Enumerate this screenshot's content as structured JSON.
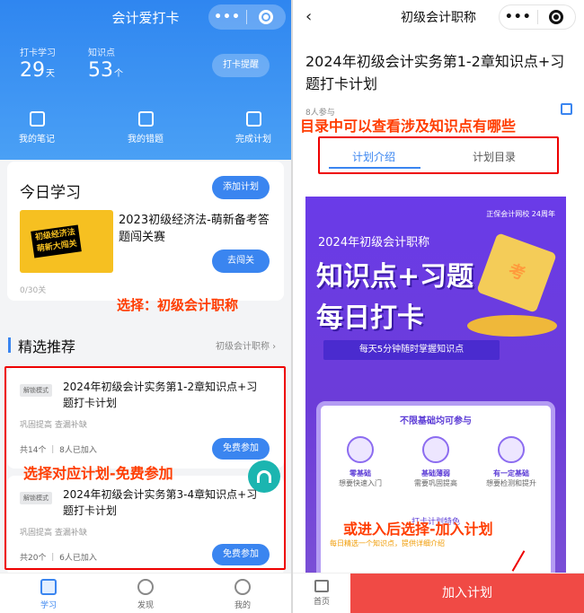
{
  "left": {
    "app_title": "会计爱打卡",
    "stats": [
      {
        "label": "打卡学习",
        "value": "29",
        "unit": "天"
      },
      {
        "label": "知识点",
        "value": "53",
        "unit": "个"
      }
    ],
    "remind_label": "打卡提醒",
    "quick_links": [
      "我的笔记",
      "我的错题",
      "完成计划"
    ],
    "today": {
      "heading": "今日学习",
      "add_plan_label": "添加计划",
      "cover_text_line1": "初级经济法",
      "cover_text_line2": "萌新大闯关",
      "course_title": "2023初级经济法-萌新备考答题闯关赛",
      "go_label": "去闯关",
      "progress": "0/30关"
    },
    "annotation_select": "选择：初级会计职称",
    "section_heading": "精选推荐",
    "filter_link": "初级会计职称 ›",
    "items": [
      {
        "badge": "解锁模式",
        "title": "2024年初级会计实务第1-2章知识点+习题打卡计划",
        "tags": "巩固提高 查漏补缺",
        "stats": "共14个 ｜ 8人已加入",
        "cta": "免费参加"
      },
      {
        "badge": "解锁模式",
        "title": "2024年初级会计实务第3-4章知识点+习题打卡计划",
        "tags": "巩固提高 查漏补缺",
        "stats": "共20个 ｜ 6人已加入",
        "cta": "免费参加"
      }
    ],
    "annotation_join": "选择对应计划-免费参加",
    "tabbar": [
      "学习",
      "发现",
      "我的"
    ]
  },
  "right": {
    "nav_title": "初级会计职称",
    "back": "‹",
    "plan_title": "2024年初级会计实务第1-2章知识点+习题打卡计划",
    "joined": "8人参与",
    "annotation_catalog": "目录中可以查看涉及知识点有哪些",
    "tabs": [
      "计划介绍",
      "计划目录"
    ],
    "poster": {
      "brand": "正保会计网校 24周年",
      "year_title": "2024年初级会计职称",
      "big_line1": "知识点+习题",
      "big_line2": "每日打卡",
      "cube_text": "考",
      "subtitle": "每天5分钟随时掌握知识点",
      "card_heading": "不限基础均可参与",
      "features": [
        {
          "title": "零基础",
          "desc": "想要快速入门"
        },
        {
          "title": "基础薄弱",
          "desc": "需要巩固提高"
        },
        {
          "title": "有一定基础",
          "desc": "想要检测和提升"
        }
      ],
      "card_footer": "打卡计划特色",
      "card_line": "每日精选一个知识点，提供详细介绍"
    },
    "annotation_enter": "或进入后选择-加入计划",
    "home_label": "首页",
    "join_label": "加入计划"
  },
  "colors": {
    "accent": "#3a85f0",
    "annotation": "#ff3c00",
    "join_button": "#f04a45",
    "poster": "#6a3be8"
  }
}
